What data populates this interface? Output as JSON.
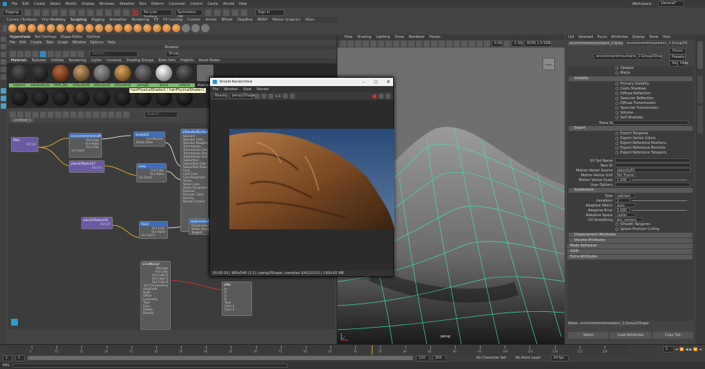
{
  "menubar": {
    "items": [
      "File",
      "Edit",
      "Create",
      "Select",
      "Modify",
      "Display",
      "Windows",
      "Skeleton",
      "Skin",
      "Deform",
      "Constrain",
      "Control",
      "Cache",
      "Arnold",
      "Help"
    ],
    "workspace_label": "Workspace :",
    "workspace_value": "General*"
  },
  "shelf1": {
    "mode": "Rigging",
    "live_surface": "No Live Surface",
    "symmetry": "Symmetry: Off",
    "sign_in": "Sign In"
  },
  "shelf_tabs": [
    "Curves / Surfaces",
    "Poly Modeling",
    "Sculpting",
    "Rigging",
    "Animation",
    "Rendering",
    "FX",
    "FX Caching",
    "Custom",
    "Arnold",
    "Bifrost",
    "Deadline",
    "MASH",
    "Motion Graphics",
    "XGen"
  ],
  "hypershade": {
    "tabs": [
      "Hypershade",
      "Tool Settings",
      "Shape Editor",
      "Outliner"
    ],
    "menu": [
      "File",
      "Edit",
      "Create",
      "Tabs",
      "Graph",
      "Window",
      "Options",
      "Help"
    ],
    "browser_label": "Browser",
    "search_placeholder": "Search...",
    "show_label": "Show",
    "browser_tabs": [
      "Materials",
      "Textures",
      "Utilities",
      "Rendering",
      "Lights",
      "Cameras",
      "Shading Groups",
      "Bake Sets",
      "Projects",
      "Asset Nodes"
    ],
    "materials_row1": [
      "lambert1",
      "standardSurfa",
      "PXAR_SKA",
      "aiStandardS",
      "aiStandardS",
      "aiStandardS",
      "phongE1",
      "blinn1",
      "aiHairSt"
    ],
    "tooltip": "hairPhysicalShader1 / hairPhysicalShader1",
    "material_label": "Material Viewer",
    "graph_tab": "Untitled_1",
    "node_search_placeholder": "Search...",
    "nodes": {
      "file1": {
        "title": "ffile1",
        "row": "Out UV"
      },
      "file2": {
        "title": "place2dTexture17",
        "row": "Out UV"
      },
      "tex1": {
        "title": "environmentcinemaMaterials_1.TIM_p3_v1.exr",
        "rows": [
          "Out Color",
          "Out Alpha",
          "Out Color",
          "Uv Coord"
        ]
      },
      "tex2": {
        "title": "ramp",
        "rows": [
          "Out Color",
          "Out Alpha",
          "Out Color",
          "Uv Coord"
        ]
      },
      "bump": {
        "title": "bump2d2",
        "rows": [
          "Out Normal",
          "Bump Value"
        ]
      },
      "place3": {
        "title": "place2dTexture18",
        "row": "Out UV"
      },
      "file3": {
        "title": "file22",
        "rows": [
          "Out Color",
          "Out Alpha",
          "Uv Coord"
        ]
      },
      "disp": {
        "title": "displacementShader",
        "rows": [
          "Displacement",
          "Vector Displace",
          "Tangent"
        ]
      },
      "shader": {
        "title": "aiStandardSurface",
        "rows": [
          "Specular",
          "Specular Color",
          "Specular Roughness",
          "Transmission",
          "Transmission Color",
          "Transmission Depth",
          "Transmission Scatter",
          "Subsurface",
          "Subsurface Color",
          "Subsurface Radius",
          "Coat",
          "Coat Color",
          "Coat Roughness",
          "Sheen",
          "Sheen Color",
          "Sheen Roughness",
          "Emission",
          "Emission Color",
          "Opacity",
          "Normal Camera"
        ]
      },
      "cellnoise": {
        "title": "aiCellNoise2",
        "rows": [
          "Message",
          "Out Color",
          "Out Color R",
          "Out Color G",
          "Out Color B",
          "Out Transparency",
          "Amplitude",
          "Scale",
          "Offset",
          "Lacunarity",
          "Time",
          "Color",
          "Palette",
          "Density"
        ]
      },
      "mix": {
        "title": "aiMix",
        "rows": [
          "In",
          "R",
          "G",
          "B",
          "Tone",
          "Color 1",
          "Color 2"
        ]
      }
    }
  },
  "viewport": {
    "menu": [
      "View",
      "Shading",
      "Lighting",
      "Show",
      "Renderer",
      "Panels"
    ],
    "camera": "persp",
    "cube_label": "FRONT",
    "numbers": [
      "0.00",
      "1.00"
    ],
    "color_mode": "ACES 1.0 SDR-video (sRGB)"
  },
  "renderview": {
    "title": "Arnold RenderView",
    "menu": [
      "File",
      "Window",
      "View",
      "Render"
    ],
    "mode": "Beauty",
    "camera": "persp2Shape",
    "zoom": "1:1",
    "status": "00:00:16 | 960x540 (1:1) | persp2Shape | samples 3/4/2/2/2/2 | 1909.62 MB"
  },
  "ae": {
    "menu": [
      "List",
      "Selected",
      "Focus",
      "Attributes",
      "Display",
      "Show",
      "Help"
    ],
    "tabs": [
      "environmentmountains_2:Group2Shape",
      "environmentmountains_2:Group2Shape"
    ],
    "focus_label": "Focus",
    "presets_label": "Presets",
    "show_label": "Show",
    "hide_label": "Hide",
    "top_checks": [
      "Opaque",
      "Matte"
    ],
    "visibility_title": "Visibility",
    "visibility": [
      "Primary Visibility",
      "Casts Shadows",
      "Diffuse Reflection",
      "Specular Reflection",
      "Diffuse Transmission",
      "Specular Transmission",
      "Volume",
      "Self Shadows"
    ],
    "trace_sets": "Trace Sets",
    "export_title": "Export",
    "export": [
      "Export Tangents",
      "Export Vertex Colors",
      "Export Reference Positions",
      "Export Reference Normals",
      "Export Reference Tangents"
    ],
    "uv_label": "UV Set Name",
    "uv_value": "",
    "tan_label": "Tans ID",
    "mv_label": "Motion Vector Source",
    "mv_value": "velocityPV",
    "mvu_label": "Motion Vector Unit",
    "mvu_value": "Per Frame",
    "mvs_label": "Motion Vector Scale",
    "mvs_value": "1.000",
    "user_label": "User Options",
    "subdiv_title": "Subdivision",
    "type_label": "Type",
    "type_value": "catclark",
    "iter_label": "Iterations",
    "iter_value": "1",
    "metric_label": "Adaptive Metric",
    "metric_value": "auto",
    "err_label": "Adaptive Error",
    "err_value": "0.000",
    "space_label": "Adaptive Space",
    "space_value": "raster",
    "uvsmooth_label": "UV Smoothing",
    "uvsmooth_value": "pin_corners",
    "smooth_checks": [
      "Smooth Tangents",
      "Ignore Frustum Culling"
    ],
    "collapsed": [
      "Displacement Attributes",
      "Volume Attributes",
      "Mode Refresher",
      "UUID",
      "Extra Attributes"
    ],
    "notes_label": "Notes: environmentmountains_2:Group2Shape",
    "bottom": [
      "Select",
      "Load Attributes",
      "Copy Tab"
    ]
  },
  "timeline": {
    "ticks": [
      "5",
      "10",
      "15",
      "20",
      "25",
      "30",
      "35",
      "40",
      "45",
      "50",
      "55",
      "60",
      "65",
      "70",
      "75",
      "80",
      "85",
      "90",
      "95",
      "100",
      "105",
      "110",
      "115",
      "120"
    ],
    "current": "1",
    "range_start": "1",
    "range_end": "120",
    "end_value": "200",
    "fps": "24 fps",
    "character_set": "No Character Set",
    "anim_layer": "No Anim Layer"
  },
  "status": {
    "mode": "MEL"
  }
}
